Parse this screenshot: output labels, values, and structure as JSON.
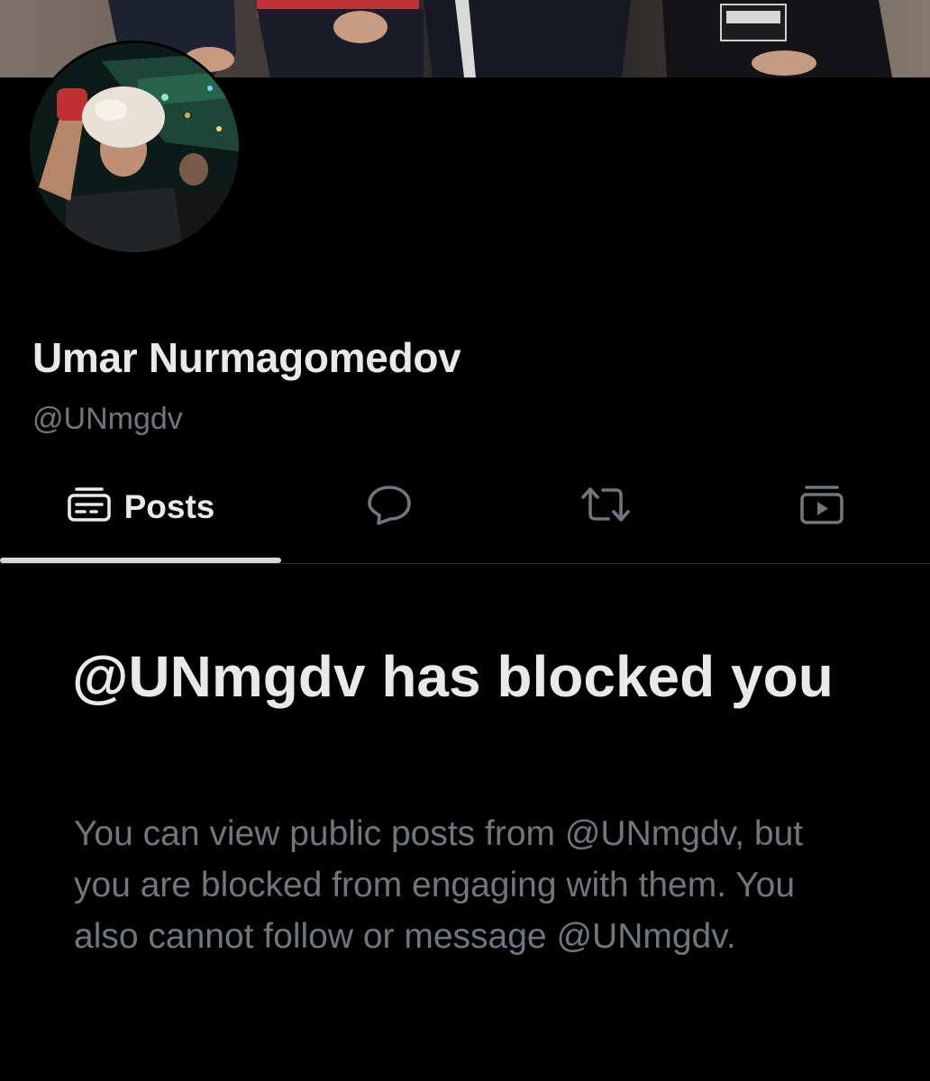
{
  "profile": {
    "display_name": "Umar Nurmagomedov",
    "handle": "@UNmgdv",
    "banner_image": "group photo of men seated on a couch",
    "avatar_image": "fighter wearing a white fur papakha hat raising a gloved fist in an arena"
  },
  "tabs": [
    {
      "label": "Posts",
      "icon": "posts-icon",
      "active": true
    },
    {
      "label": "",
      "icon": "replies-icon",
      "active": false
    },
    {
      "label": "",
      "icon": "reposts-icon",
      "active": false
    },
    {
      "label": "",
      "icon": "media-icon",
      "active": false
    }
  ],
  "blocked_notice": {
    "title": "@UNmgdv has blocked you",
    "body": "You can view public posts from @UNmgdv, but you are blocked from engaging with them. You also cannot follow or message @UNmgdv."
  },
  "colors": {
    "background": "#000000",
    "primary_text": "#e7e9ea",
    "secondary_text": "#71767b",
    "divider": "#2f3336"
  }
}
